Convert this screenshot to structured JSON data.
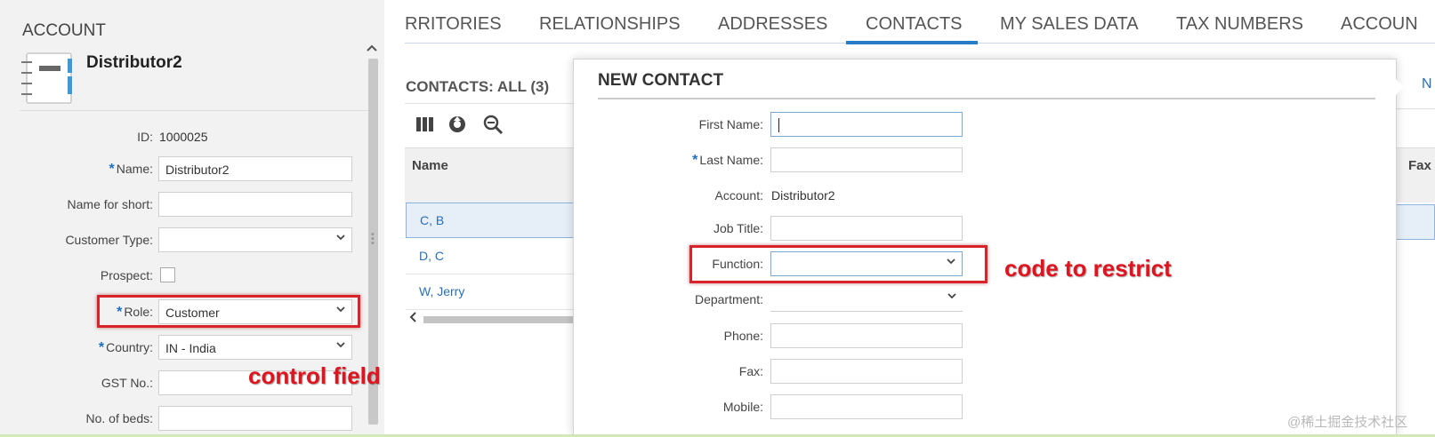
{
  "account": {
    "section_title": "ACCOUNT",
    "name": "Distributor2",
    "fields": {
      "id_label": "ID:",
      "id_value": "1000025",
      "name_label": "Name:",
      "name_value": "Distributor2",
      "short_label": "Name for short:",
      "short_value": "",
      "type_label": "Customer Type:",
      "type_value": "",
      "prospect_label": "Prospect:",
      "role_label": "Role:",
      "role_value": "Customer",
      "country_label": "Country:",
      "country_value": "IN - India",
      "gst_label": "GST No.:",
      "gst_value": "",
      "beds_label": "No. of beds:",
      "beds_value": ""
    },
    "required_mark": "*"
  },
  "tabs": [
    {
      "label": "RRITORIES"
    },
    {
      "label": "RELATIONSHIPS"
    },
    {
      "label": "ADDRESSES"
    },
    {
      "label": "CONTACTS",
      "active": true
    },
    {
      "label": "MY SALES DATA"
    },
    {
      "label": "TAX NUMBERS"
    },
    {
      "label": "ACCOUN"
    }
  ],
  "contacts": {
    "title": "CONTACTS: ALL (3)",
    "column_name": "Name",
    "rows": [
      {
        "name": "C, B",
        "selected": true
      },
      {
        "name": "D, C"
      },
      {
        "name": "W, Jerry"
      }
    ],
    "right_link": "N",
    "right_column": "Fax"
  },
  "dialog": {
    "title": "NEW CONTACT",
    "first_name_label": "First Name:",
    "last_name_label": "Last Name:",
    "account_label": "Account:",
    "account_value": "Distributor2",
    "job_title_label": "Job Title:",
    "function_label": "Function:",
    "department_label": "Department:",
    "phone_label": "Phone:",
    "fax_label": "Fax:",
    "mobile_label": "Mobile:"
  },
  "annotations": {
    "control_field": "control field",
    "code_to_restrict": "code to restrict",
    "highlight_color": "#d9232a"
  },
  "watermark": "@稀土掘金技术社区",
  "colors": {
    "accent": "#2a7bc6",
    "link": "#2a6fb6",
    "required": "#1a6fc1",
    "annotation": "#e0141e"
  },
  "icons": [
    "account-notebook-icon",
    "columns-icon",
    "refresh-icon",
    "zoom-icon",
    "chevron-down-icon",
    "chevron-up-icon",
    "chevron-left-icon"
  ]
}
